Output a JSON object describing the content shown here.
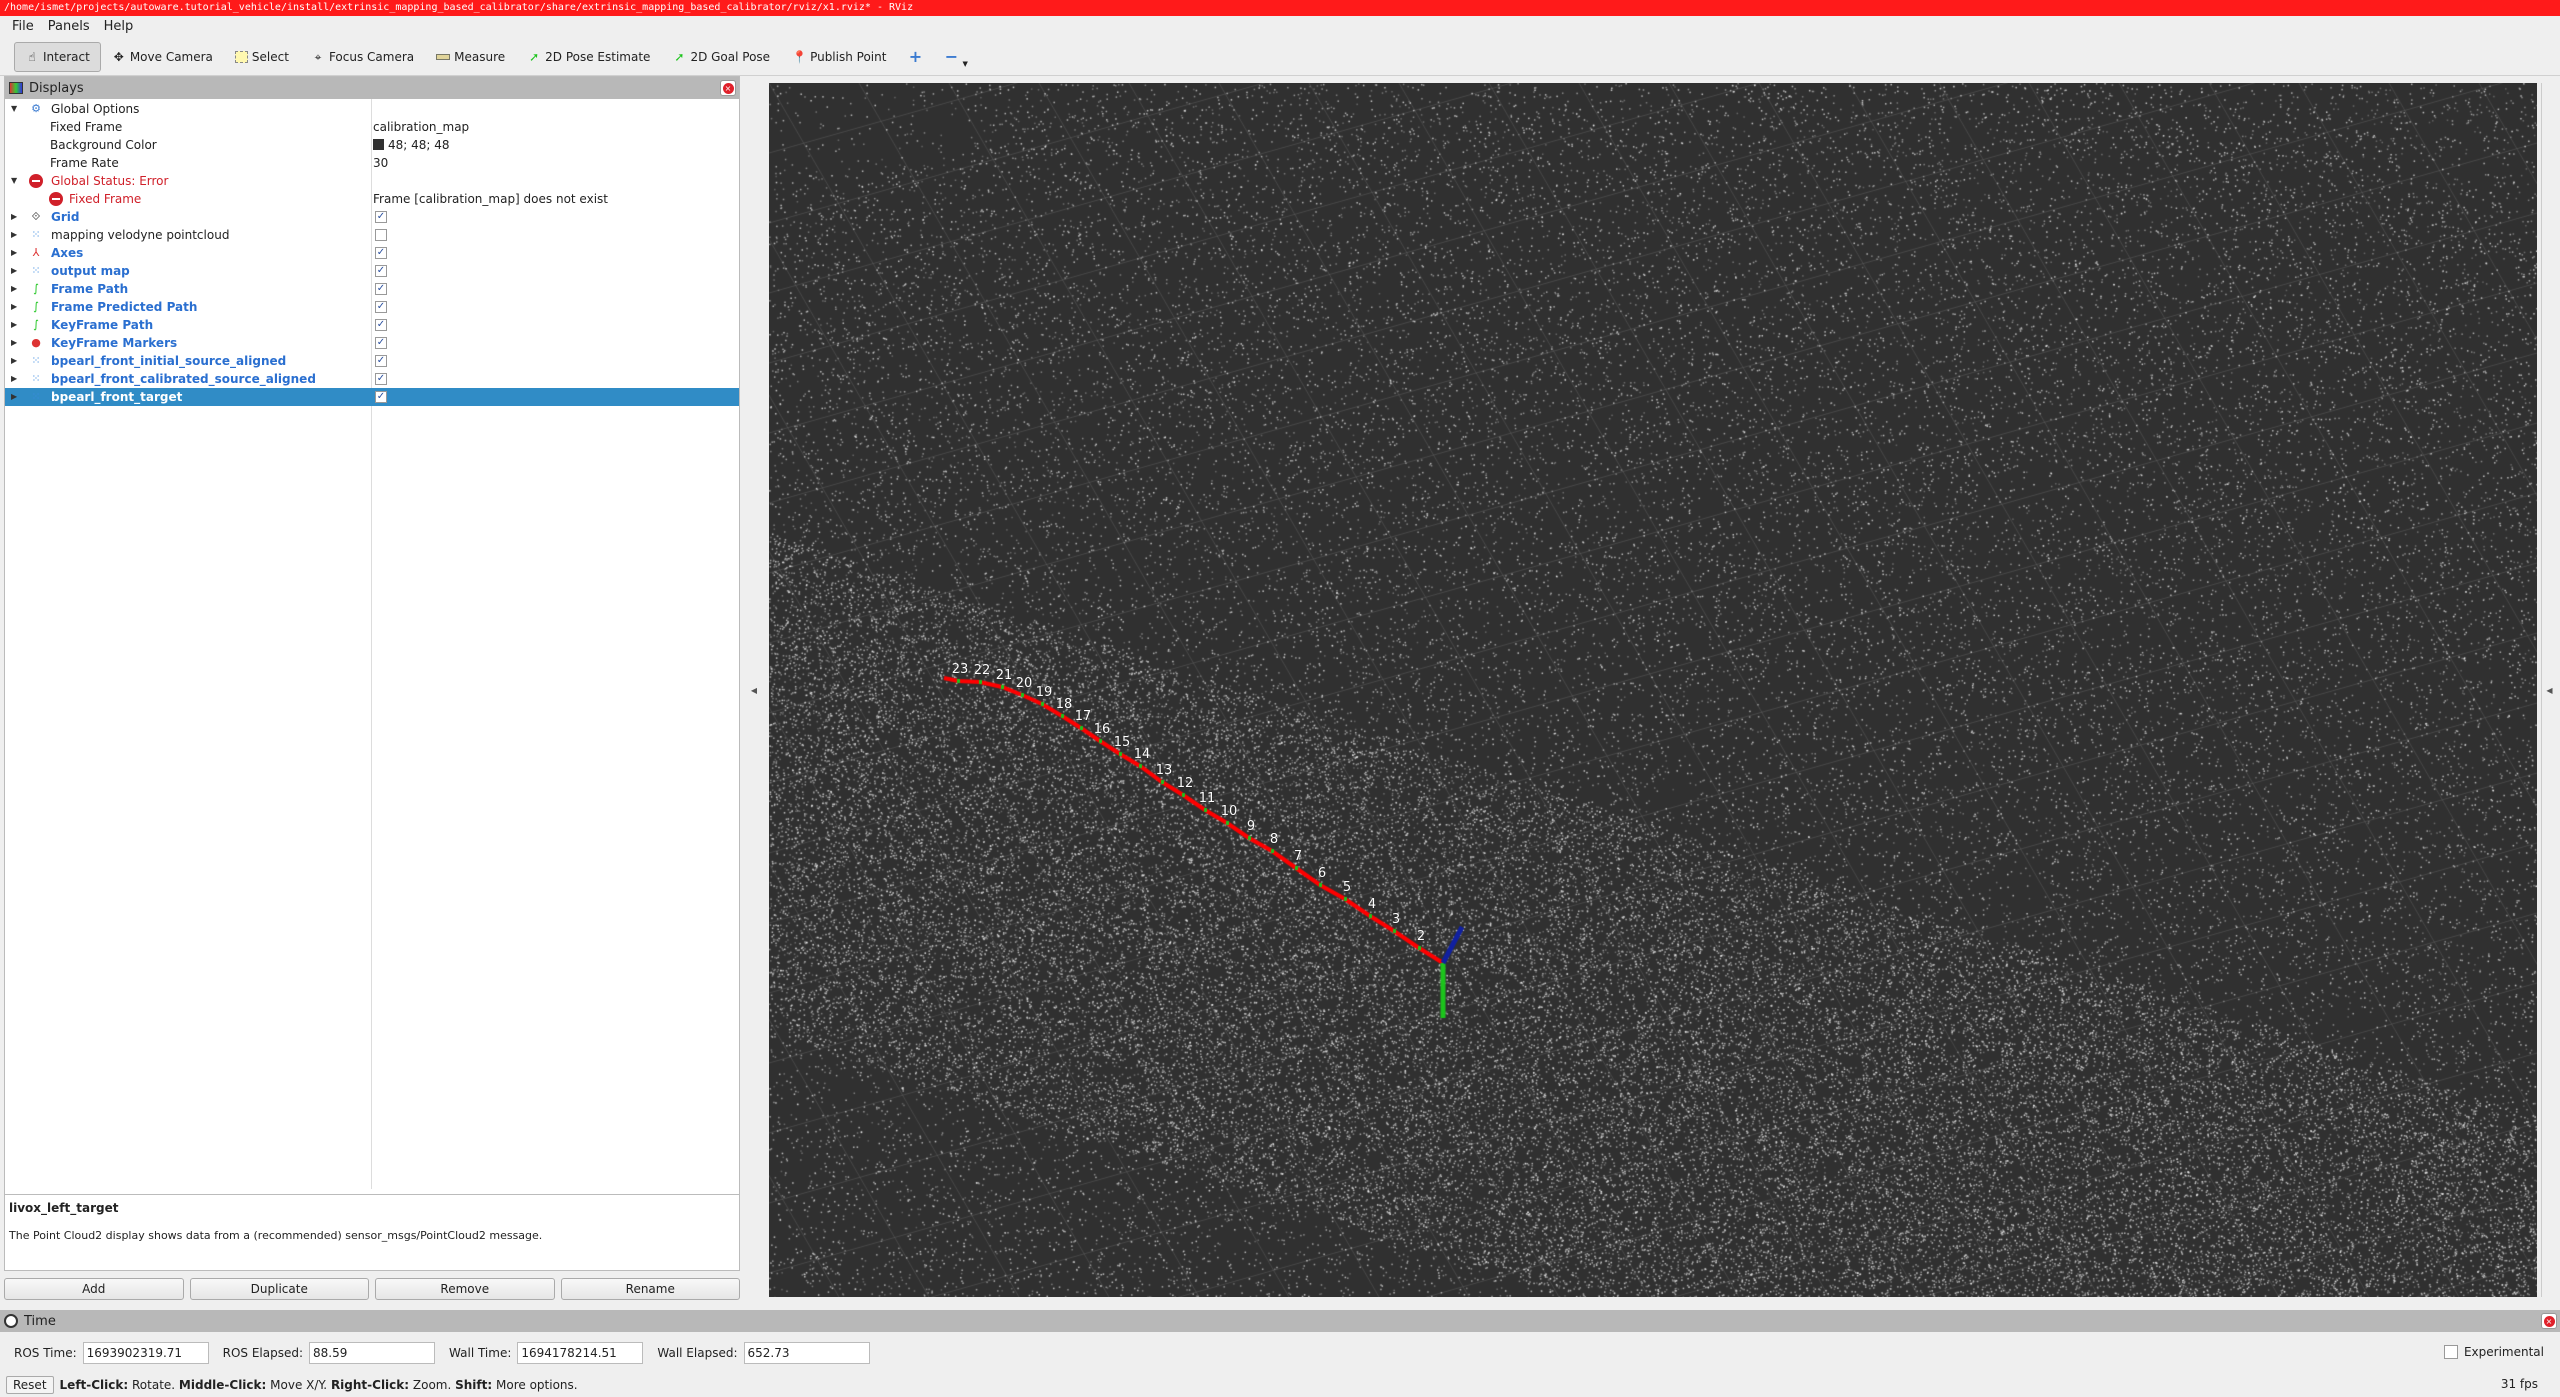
{
  "window": {
    "title": "/home/ismet/projects/autoware.tutorial_vehicle/install/extrinsic_mapping_based_calibrator/share/extrinsic_mapping_based_calibrator/rviz/x1.rviz* - RViz"
  },
  "menu": [
    "File",
    "Panels",
    "Help"
  ],
  "toolbar": [
    {
      "label": "Interact",
      "icon": "hand-icon",
      "active": true
    },
    {
      "label": "Move Camera",
      "icon": "move-camera-icon"
    },
    {
      "label": "Select",
      "icon": "select-icon"
    },
    {
      "label": "Focus Camera",
      "icon": "focus-camera-icon"
    },
    {
      "label": "Measure",
      "icon": "ruler-icon"
    },
    {
      "label": "2D Pose Estimate",
      "icon": "green-arrow-icon"
    },
    {
      "label": "2D Goal Pose",
      "icon": "green-arrow-icon"
    },
    {
      "label": "Publish Point",
      "icon": "map-pin-icon"
    },
    {
      "label": "",
      "icon": "plus-icon"
    },
    {
      "label": "",
      "icon": "minus-icon"
    }
  ],
  "displays": {
    "title": "Displays",
    "global_options": {
      "label": "Global Options",
      "fixed_frame_label": "Fixed Frame",
      "fixed_frame": "calibration_map",
      "bg_label": "Background Color",
      "bg_value": "48; 48; 48",
      "bg_color": "#303030",
      "frame_rate_label": "Frame Rate",
      "frame_rate": "30"
    },
    "global_status": {
      "label": "Global Status: Error",
      "child_label": "Fixed Frame",
      "child_value": "Frame [calibration_map] does not exist"
    },
    "items": [
      {
        "label": "Grid",
        "checked": true,
        "icon": "grid-icon"
      },
      {
        "label": "mapping velodyne pointcloud",
        "checked": false,
        "icon": "pointcloud-icon"
      },
      {
        "label": "Axes",
        "checked": true,
        "icon": "axes-icon"
      },
      {
        "label": "output map",
        "checked": true,
        "icon": "pointcloud-icon"
      },
      {
        "label": "Frame Path",
        "checked": true,
        "icon": "path-icon"
      },
      {
        "label": "Frame Predicted Path",
        "checked": true,
        "icon": "path-icon"
      },
      {
        "label": "KeyFrame Path",
        "checked": true,
        "icon": "path-icon"
      },
      {
        "label": "KeyFrame Markers",
        "checked": true,
        "icon": "markers-icon"
      },
      {
        "label": "bpearl_front_initial_source_aligned",
        "checked": true,
        "icon": "pointcloud-icon"
      },
      {
        "label": "bpearl_front_calibrated_source_aligned",
        "checked": true,
        "icon": "pointcloud-icon"
      },
      {
        "label": "bpearl_front_target",
        "checked": true,
        "icon": "pointcloud-icon",
        "selected": true
      }
    ]
  },
  "description": {
    "title": "livox_left_target",
    "text": "The Point Cloud2 display shows data from a (recommended) sensor_msgs/PointCloud2 message."
  },
  "buttons": {
    "add": "Add",
    "duplicate": "Duplicate",
    "remove": "Remove",
    "rename": "Rename"
  },
  "viewport": {
    "keyframe_labels": [
      "23",
      "22",
      "21",
      "20",
      "19",
      "18",
      "17",
      "16",
      "15",
      "14",
      "13",
      "12",
      "11",
      "10",
      "9",
      "8",
      "7",
      "6",
      "5",
      "4",
      "3",
      "2"
    ],
    "path_color": "#ff0000"
  },
  "time": {
    "title": "Time",
    "ros_time_label": "ROS Time:",
    "ros_time": "1693902319.71",
    "ros_elapsed_label": "ROS Elapsed:",
    "ros_elapsed": "88.59",
    "wall_time_label": "Wall Time:",
    "wall_time": "1694178214.51",
    "wall_elapsed_label": "Wall Elapsed:",
    "wall_elapsed": "652.73",
    "experimental_label": "Experimental",
    "experimental": false
  },
  "status": {
    "reset": "Reset",
    "hint_parts": [
      {
        "b": "Left-Click:",
        "t": " Rotate. "
      },
      {
        "b": "Middle-Click:",
        "t": " Move X/Y. "
      },
      {
        "b": "Right-Click:",
        "t": " Zoom. "
      },
      {
        "b": "Shift:",
        "t": " More options."
      }
    ],
    "fps": "31 fps"
  }
}
